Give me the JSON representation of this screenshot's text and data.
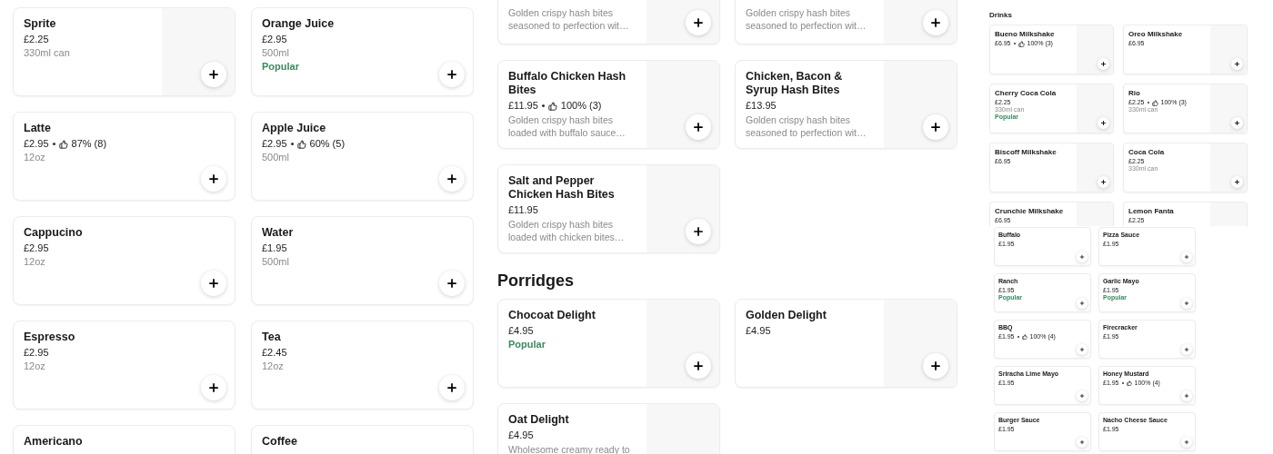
{
  "left_screen": {
    "items": [
      {
        "kind": "full",
        "name": "Sprite",
        "price": "£2.25",
        "size": "330ml can",
        "image_placeholder": true
      },
      {
        "kind": "full",
        "name": "Orange Juice",
        "price": "£2.95",
        "size": "500ml",
        "badge": "Popular"
      },
      {
        "kind": "full",
        "name": "Latte",
        "price": "£2.95",
        "rating": "87% (8)",
        "size": "12oz"
      },
      {
        "kind": "full",
        "name": "Apple Juice",
        "price": "£2.95",
        "rating": "60% (5)",
        "size": "500ml"
      },
      {
        "kind": "full",
        "name": "Cappucino",
        "price": "£2.95",
        "size": "12oz"
      },
      {
        "kind": "full",
        "name": "Water",
        "price": "£1.95",
        "size": "500ml"
      },
      {
        "kind": "full",
        "name": "Espresso",
        "price": "£2.95",
        "size": "12oz"
      },
      {
        "kind": "full",
        "name": "Tea",
        "price": "£2.45",
        "size": "12oz"
      },
      {
        "kind": "partial_bottom",
        "name": "Americano"
      },
      {
        "kind": "partial_bottom",
        "name": "Coffee"
      }
    ]
  },
  "middle_screen": {
    "items": [
      {
        "kind": "partial_top",
        "description": "Golden crispy hash bites seasoned to perfection wit…",
        "image_placeholder": true
      },
      {
        "kind": "partial_top",
        "description": "Golden crispy hash bites seasoned to perfection wit…",
        "image_placeholder": true
      },
      {
        "kind": "full",
        "name": "Buffalo Chicken Hash Bites",
        "price": "£11.95",
        "rating": "100% (3)",
        "description": "Golden crispy hash bites loaded with buffalo sauce…",
        "image_placeholder": true
      },
      {
        "kind": "full",
        "name": "Chicken, Bacon & Syrup Hash Bites",
        "price": "£13.95",
        "description": "Golden crispy hash bites seasoned to perfection wit…",
        "image_placeholder": true
      },
      {
        "kind": "full",
        "name": "Salt and Pepper Chicken Hash Bites",
        "price": "£11.95",
        "description": "Golden crispy hash bites loaded with chicken bites…",
        "image_placeholder": true
      }
    ],
    "sections": [
      {
        "heading": "Porridges",
        "items": [
          {
            "kind": "full",
            "name": "Chocoat Delight",
            "price": "£4.95",
            "badge": "Popular",
            "image_placeholder": true
          },
          {
            "kind": "full",
            "name": "Golden Delight",
            "price": "£4.95",
            "image_placeholder": true
          },
          {
            "kind": "partial_bottom",
            "name": "Oat Delight",
            "price": "£4.95",
            "description": "Wholesome creamy ready to",
            "image_placeholder": true
          }
        ]
      }
    ]
  },
  "right_screen": {
    "heading": "Drinks",
    "items": [
      {
        "kind": "full",
        "name": "Bueno Milkshake",
        "price": "£6.95",
        "rating": "100% (3)",
        "image_placeholder": true
      },
      {
        "kind": "full",
        "name": "Oreo Milkshake",
        "price": "£6.95",
        "image_placeholder": true
      },
      {
        "kind": "full",
        "name": "Cherry Coca Cola",
        "price": "£2.25",
        "size": "330ml can",
        "badge": "Popular",
        "image_placeholder": true
      },
      {
        "kind": "full",
        "name": "Rio",
        "price": "£2.25",
        "rating": "100% (3)",
        "size": "330ml can",
        "image_placeholder": true
      },
      {
        "kind": "full",
        "name": "Biscoff Milkshake",
        "price": "£6.95",
        "image_placeholder": true
      },
      {
        "kind": "full",
        "name": "Coca Cola",
        "price": "£2.25",
        "size": "330ml can",
        "image_placeholder": true
      },
      {
        "kind": "partial_bottom",
        "name": "Crunchie Milkshake",
        "price": "£6.95",
        "image_placeholder": true
      },
      {
        "kind": "partial_bottom",
        "name": "Lemon Fanta",
        "price": "£2.25",
        "image_placeholder": true
      }
    ],
    "sauces": [
      {
        "kind": "full",
        "name": "Buffalo",
        "price": "£1.95"
      },
      {
        "kind": "full",
        "name": "Pizza Sauce",
        "price": "£1.95"
      },
      {
        "kind": "full",
        "name": "Ranch",
        "price": "£1.95",
        "badge": "Popular"
      },
      {
        "kind": "full",
        "name": "Garlic Mayo",
        "price": "£1.95",
        "badge": "Popular"
      },
      {
        "kind": "full",
        "name": "BBQ",
        "price": "£1.95",
        "rating": "100% (4)"
      },
      {
        "kind": "full",
        "name": "Firecracker",
        "price": "£1.95"
      },
      {
        "kind": "full",
        "name": "Sriracha Lime Mayo",
        "price": "£1.95"
      },
      {
        "kind": "full",
        "name": "Honey Mustard",
        "price": "£1.95",
        "rating": "100% (4)"
      },
      {
        "kind": "full",
        "name": "Burger Sauce",
        "price": "£1.95"
      },
      {
        "kind": "full",
        "name": "Nacho Cheese Sauce",
        "price": "£1.95"
      }
    ]
  }
}
